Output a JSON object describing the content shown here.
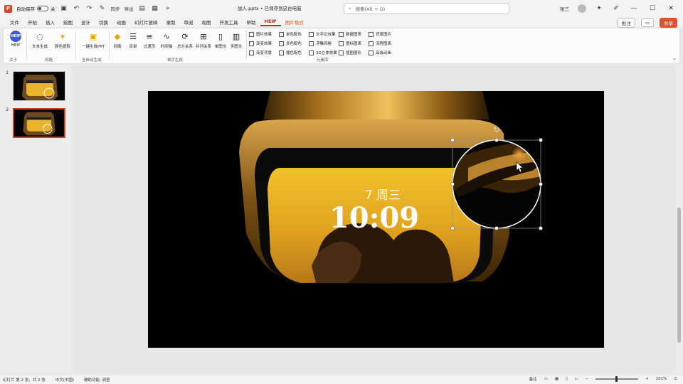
{
  "titlebar": {
    "autosave_label": "自动保存",
    "autosave_state": "关",
    "save_icon": "save-icon",
    "extra_label1": "同步",
    "extra_label2": "导出",
    "doc_title": "战人.pptx • 已保存到这台电脑",
    "search_placeholder": "搜索(Alt + Q)",
    "user_name": "张三",
    "minimize": "—",
    "maximize": "☐",
    "close": "✕"
  },
  "menu": {
    "tabs": [
      "文件",
      "开始",
      "插入",
      "绘图",
      "设计",
      "切换",
      "动画",
      "幻灯片放映",
      "录制",
      "审阅",
      "视图",
      "开发工具",
      "帮助",
      "HEIP",
      "图片格式"
    ],
    "active_index": 13,
    "orange_index": 14,
    "comment_label": "批注",
    "share_label": "共享"
  },
  "ribbon": {
    "help_btn": "HEIP",
    "about_label": "关于",
    "style_label": "风格",
    "btn_text_to_slide": "文本生成",
    "btn_color": "颜色提取",
    "btn_onekey": "一键生成PPT",
    "btn_cover": "封面",
    "btn_toc": "目录",
    "btn_transition": "过渡页",
    "btn_timeline": "时间轴",
    "btn_relation": "总分关系",
    "btn_parallel": "并列关系",
    "btn_single": "单图文",
    "btn_multi": "多图文",
    "group_auto": "全自动生成",
    "group_single": "单页生成",
    "group_lib": "元素库",
    "checks": [
      [
        "图片效果",
        "单色配色",
        "文字云效果",
        "数据图表",
        "背景图片"
      ],
      [
        "渐变效果",
        "多色配色",
        "浮雕风格",
        "图标图表",
        "流程图表"
      ],
      [
        "渐变背景",
        "撞色配色",
        "3D立体效果",
        "插图图形",
        "高级动画"
      ]
    ]
  },
  "slides": {
    "numbers": [
      "1",
      "2"
    ],
    "selected": 1
  },
  "slide_content": {
    "weekday": "7 周三",
    "time": "10:09"
  },
  "statusbar": {
    "slide_pos": "幻灯片 第 2 张，共 2 张",
    "language": "中文(中国)",
    "accessibility": "辅助功能: 调查",
    "notes": "备注",
    "zoom": "101%"
  }
}
